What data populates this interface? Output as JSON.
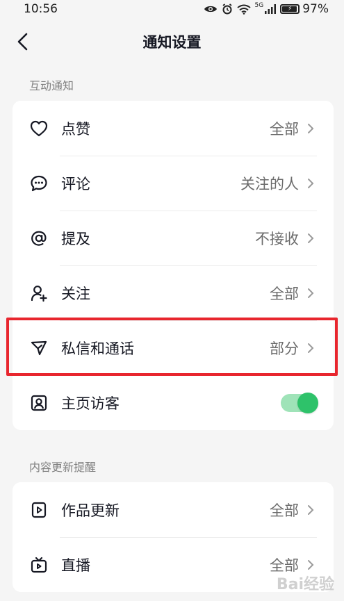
{
  "status_bar": {
    "time": "10:56",
    "network_label": "5G",
    "battery_percent": "97%",
    "battery_level": 0.97
  },
  "nav": {
    "title": "通知设置"
  },
  "sections": [
    {
      "title": "互动通知",
      "rows": [
        {
          "label": "点赞",
          "value": "全部",
          "icon": "heart-icon"
        },
        {
          "label": "评论",
          "value": "关注的人",
          "icon": "comment-icon"
        },
        {
          "label": "提及",
          "value": "不接收",
          "icon": "at-icon"
        },
        {
          "label": "关注",
          "value": "全部",
          "icon": "add-user-icon"
        },
        {
          "label": "私信和通话",
          "value": "部分",
          "icon": "send-icon"
        },
        {
          "label": "主页访客",
          "toggle": true,
          "icon": "profile-icon"
        }
      ]
    },
    {
      "title": "内容更新提醒",
      "rows": [
        {
          "label": "作品更新",
          "value": "全部",
          "icon": "video-icon"
        },
        {
          "label": "直播",
          "value": "全部",
          "icon": "tv-icon"
        }
      ]
    }
  ],
  "watermark": {
    "text": "Bai经验"
  },
  "colors": {
    "accent_green": "#2ec26a",
    "highlight_red": "#e8262e",
    "background": "#f5f5f5"
  }
}
